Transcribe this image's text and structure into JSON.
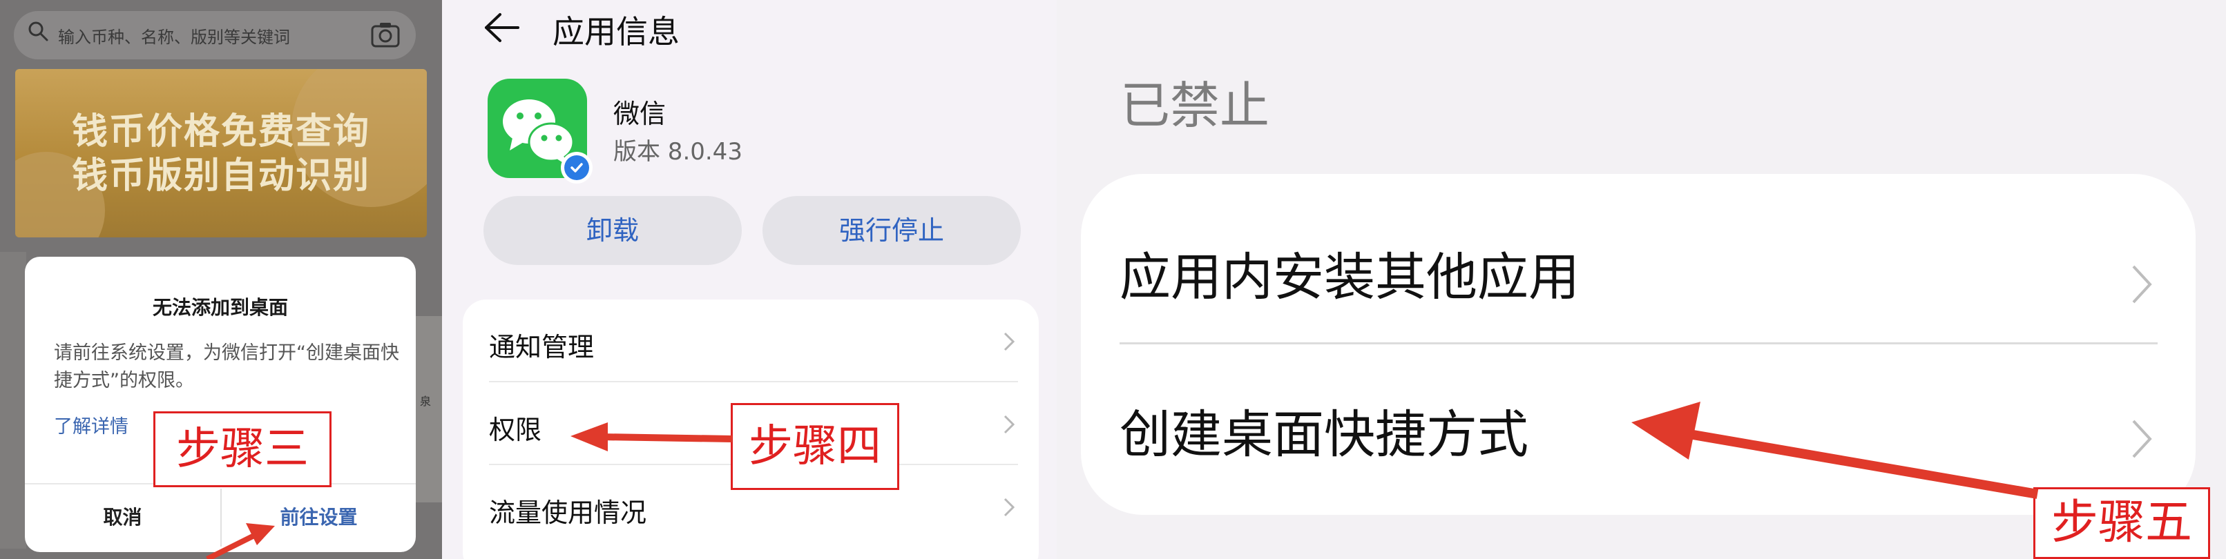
{
  "panel1": {
    "search_placeholder": "输入币种、名称、版别等关键词",
    "banner_line1": "钱币价格免费查询",
    "banner_line2": "钱币版别自动识别",
    "strip_text": "泉",
    "dialog": {
      "title": "无法添加到桌面",
      "message": "请前往系统设置，为微信打开“创建桌面快捷方式”的权限。",
      "learn_more": "了解详情",
      "cancel": "取消",
      "confirm": "前往设置"
    }
  },
  "panel2": {
    "page_title": "应用信息",
    "app_name": "微信",
    "app_version": "版本 8.0.43",
    "uninstall": "卸载",
    "force_stop": "强行停止",
    "rows": [
      "通知管理",
      "权限",
      "流量使用情况"
    ]
  },
  "panel3": {
    "header": "已禁止",
    "rows": [
      "应用内安装其他应用",
      "创建桌面快捷方式"
    ]
  },
  "steps": {
    "step3": "步骤三",
    "step4": "步骤四",
    "step5": "步骤五"
  },
  "colors": {
    "annotation_red": "#e02020",
    "link_blue": "#3b66b0",
    "wechat_green": "#2bc04e"
  },
  "icons": [
    "search-icon",
    "camera-icon",
    "back-arrow-icon",
    "wechat-icon",
    "verified-badge-icon",
    "chevron-right-icon"
  ]
}
